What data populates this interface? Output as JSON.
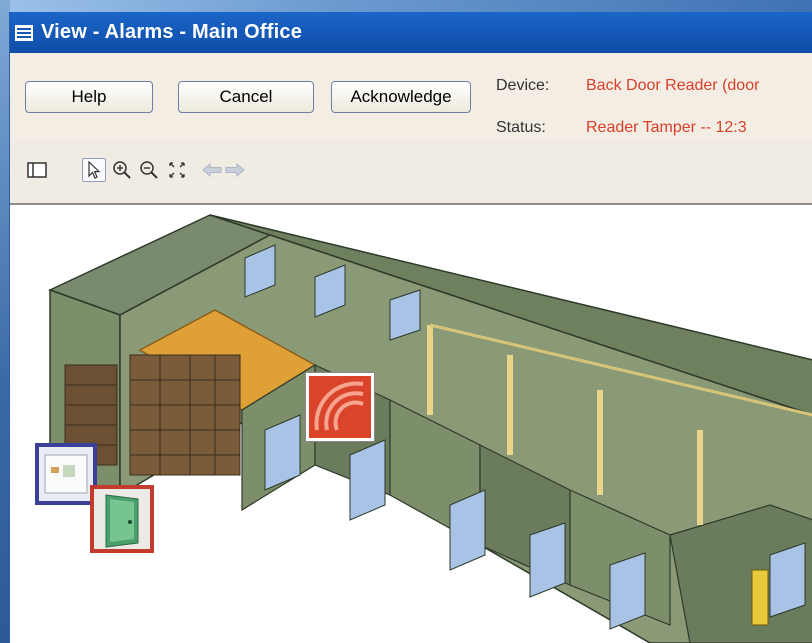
{
  "window": {
    "title": "View - Alarms - Main Office"
  },
  "buttons": {
    "help": "Help",
    "cancel": "Cancel",
    "acknowledge": "Acknowledge"
  },
  "details": {
    "device_label": "Device:",
    "device_value": "Back Door Reader (door",
    "status_label": "Status:",
    "status_value": "Reader Tamper  --  12:3"
  },
  "colors": {
    "alert": "#d8402a",
    "titlebar": "#1559b8",
    "highlight_floor": "#e0a038"
  }
}
